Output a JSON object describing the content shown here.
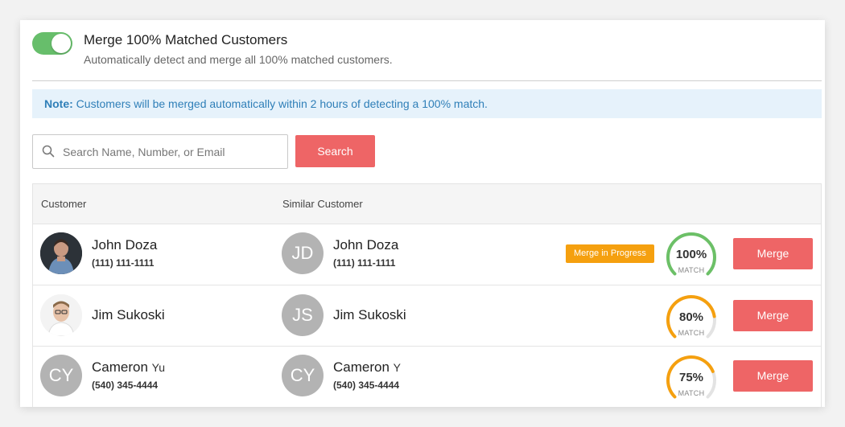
{
  "header": {
    "title": "Merge 100% Matched Customers",
    "subtitle": "Automatically detect and merge all 100% matched customers.",
    "toggle_on": true
  },
  "note": {
    "label": "Note:",
    "text": " Customers will be merged automatically within 2 hours of detecting a 100% match."
  },
  "search": {
    "placeholder": "Search Name, Number, or Email",
    "value": "",
    "button_label": "Search"
  },
  "table": {
    "col_customer": "Customer",
    "col_similar": "Similar Customer",
    "rows": [
      {
        "customer": {
          "initials": "",
          "name": "John Doza",
          "suffix": "",
          "phone": "(111) 111-1111",
          "photo": "photo-dark"
        },
        "similar": {
          "initials": "JD",
          "name": "John Doza",
          "suffix": "",
          "phone": "(111) 111-1111"
        },
        "badge": "Merge in Progress",
        "match_pct": "100%",
        "match_value": 100,
        "match_color": "#6cc067",
        "match_label": "MATCH",
        "merge_label": "Merge"
      },
      {
        "customer": {
          "initials": "",
          "name": "Jim Sukoski",
          "suffix": "",
          "phone": "",
          "photo": "photo-light"
        },
        "similar": {
          "initials": "JS",
          "name": "Jim Sukoski",
          "suffix": "",
          "phone": ""
        },
        "badge": "",
        "match_pct": "80%",
        "match_value": 80,
        "match_color": "#f5a00f",
        "match_label": "MATCH",
        "merge_label": "Merge"
      },
      {
        "customer": {
          "initials": "CY",
          "name": "Cameron",
          "suffix": "Yu",
          "phone": "(540) 345-4444",
          "photo": ""
        },
        "similar": {
          "initials": "CY",
          "name": "Cameron",
          "suffix": "Y",
          "phone": "(540) 345-4444"
        },
        "badge": "",
        "match_pct": "75%",
        "match_value": 75,
        "match_color": "#f5a00f",
        "match_label": "MATCH",
        "merge_label": "Merge"
      }
    ]
  },
  "colors": {
    "accent": "#ee6566",
    "toggle": "#67be6b",
    "note_bg": "#e6f2fb",
    "note_text": "#2f7fb8",
    "badge": "#f5a00f"
  },
  "icons": {
    "search": "search-icon"
  }
}
